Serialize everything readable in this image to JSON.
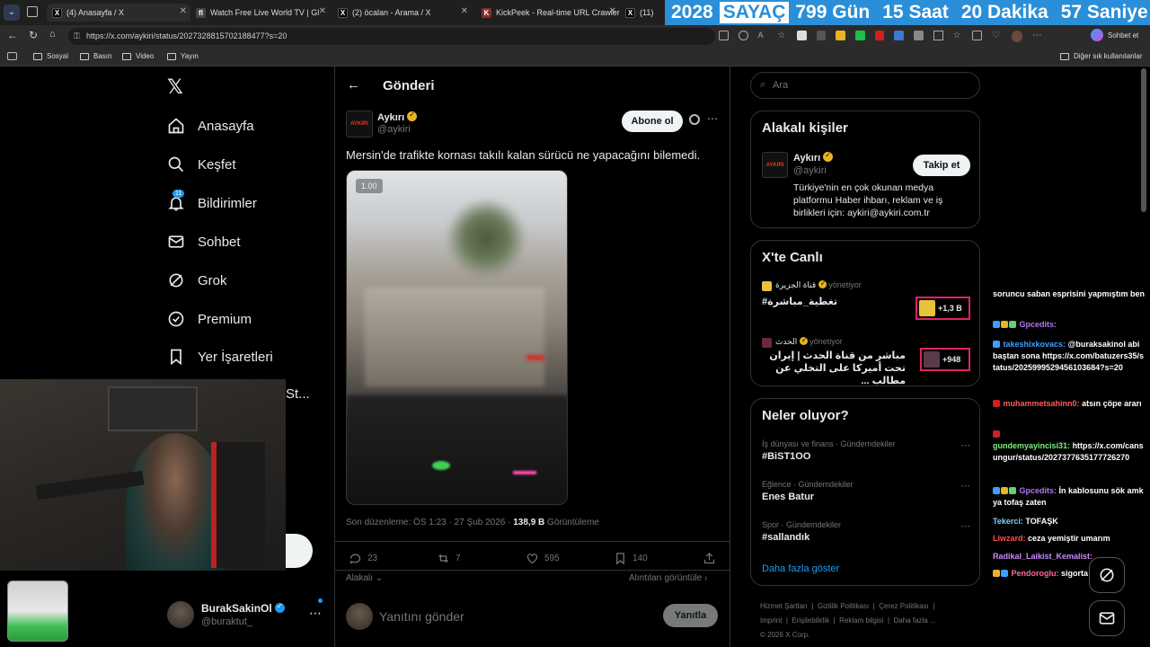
{
  "browser": {
    "tabs": [
      {
        "title": "(4) Anasayfa / X",
        "fav": "X"
      },
      {
        "title": "Watch Free Live World TV | Gl",
        "fav": "fl"
      },
      {
        "title": "(2) öcalan - Arama / X",
        "fav": "X"
      },
      {
        "title": "KickPeek - Real-time URL Crawler |",
        "fav": "K"
      },
      {
        "title": "(11)",
        "fav": "X"
      }
    ],
    "url": "https://x.com/aykiri/status/2027328815702188477?s=20",
    "profile_label": "Sohbet et",
    "bookmarks": [
      "Sosyal",
      "Basın",
      "Video",
      "Yayın"
    ],
    "other_bookmarks": "Diğer sık kullanılanlar"
  },
  "counter": {
    "year": "2028",
    "label": "SAYAÇ",
    "days": "799 Gün",
    "hours": "15 Saat",
    "minutes": "20 Dakika",
    "seconds": "57 Saniye"
  },
  "nav": {
    "items": [
      {
        "label": "Anasayfa",
        "icon": "home-icon"
      },
      {
        "label": "Keşfet",
        "icon": "search-icon"
      },
      {
        "label": "Bildirimler",
        "icon": "bell-icon",
        "badge": "11"
      },
      {
        "label": "Sohbet",
        "icon": "mail-icon"
      },
      {
        "label": "Grok",
        "icon": "grok-icon"
      },
      {
        "label": "Premium",
        "icon": "premium-icon"
      },
      {
        "label": "Yer İşaretleri",
        "icon": "bookmark-icon"
      }
    ],
    "partial_label": "St...",
    "account_name": "BurakSakinOl",
    "account_handle": "@buraktut_"
  },
  "post": {
    "header": "Gönderi",
    "author_name": "Aykırı",
    "author_handle": "@aykiri",
    "avatar_text": "AYKIRI",
    "subscribe_label": "Abone ol",
    "text": "Mersin'de trafikte kornası takılı kalan sürücü ne yapacağını bilemedi.",
    "video_speed": "1.00",
    "meta_edited": "Son düzenleme: ÖS 1:23 · 27 Şub 2026 ·",
    "views_count": "138,9 B",
    "views_label": "Görüntüleme",
    "stats": {
      "replies": "23",
      "reposts": "7",
      "likes": "595",
      "bookmarks": "140"
    },
    "relevant_label": "Alakalı",
    "quotes_label": "Alıntıları görüntüle",
    "reply_placeholder": "Yanıtını gönder",
    "reply_button": "Yanıtla"
  },
  "right": {
    "search_placeholder": "Ara",
    "relevant_people": {
      "title": "Alakalı kişiler",
      "name": "Aykırı",
      "handle": "@aykiri",
      "follow_label": "Takip et",
      "bio": "Türkiye'nin en çok okunan medya platformu Haber ihbarı, reklam ve iş birlikleri için: aykiri@aykiri.com.tr"
    },
    "live": {
      "title": "X'te Canlı",
      "items": [
        {
          "host": "قناة الجزيرة",
          "host_label": "yönetiyor",
          "title": "#تغطية_مباشرة",
          "count": "+1,3 B"
        },
        {
          "host": "الحدث",
          "host_label": "yönetiyor",
          "title": "مباشر من قناة الحدث | إيران تحت أميركا على التخلي عن مطالب ...",
          "count": "+948"
        }
      ]
    },
    "trends": {
      "title": "Neler oluyor?",
      "items": [
        {
          "category": "İş dünyası ve finans · Gündemdekiler",
          "name": "#BiST1OO"
        },
        {
          "category": "Eğlence · Gündemdekiler",
          "name": "Enes Batur"
        },
        {
          "category": "Spor · Gündemdekiler",
          "name": "#sallandık"
        }
      ],
      "more_label": "Daha fazla göster"
    },
    "footer": [
      "Hizmet Şartları",
      "Gizlilik Politikası",
      "Çerez Politikası",
      "Imprint",
      "Erişilebilirlik",
      "Reklam bilgisi",
      "Daha fazla ...",
      "© 2026 X Corp."
    ]
  },
  "chat": {
    "lines": [
      {
        "user": "",
        "user_color": "#ffffff",
        "text": "soruncu saban esprisini yapmıştım ben"
      },
      {
        "user": "Gpcedits:",
        "user_color": "#b277f0",
        "text": ""
      },
      {
        "user": "takeshixkovacs:",
        "user_color": "#3aa0ff",
        "text": "@buraksakinol abi baştan sona https://x.com/batuzers35/status/2025999529456103684?s=20"
      },
      {
        "user": "muhammetsahinn0:",
        "user_color": "#ff5a5a",
        "text": "atsın çöpe ararı"
      },
      {
        "user": "gundemyayincisi31:",
        "user_color": "#7cf07c",
        "text": "https://x.com/cansungur/status/2027377635177726270"
      },
      {
        "user": "Gpcedits:",
        "user_color": "#b277f0",
        "text": "İn kablosunu sök amk ya tofaş zaten"
      },
      {
        "user": "Tekerci:",
        "user_color": "#7fd3ff",
        "text": "TOFAŞK"
      },
      {
        "user": "Liwzard:",
        "user_color": "#ff4d4d",
        "text": "ceza yemiştir umarım"
      },
      {
        "user": "Radikal_Laikist_Kemalist:",
        "user_color": "#c88cff",
        "text": ""
      },
      {
        "user": "Pendoroglu:",
        "user_color": "#ff6a9a",
        "text": "sigorta"
      }
    ]
  },
  "colors": {
    "accent": "#1d9bf0",
    "counter_bg": "#2a8fd8",
    "gold": "#e8b423"
  }
}
